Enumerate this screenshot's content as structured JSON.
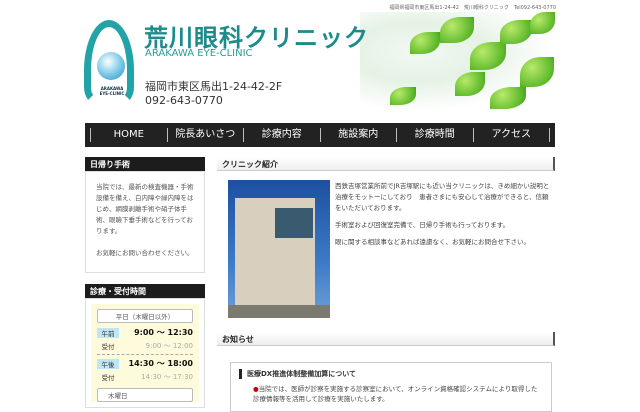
{
  "topline": "福岡県福岡市東区馬出1-24-42　荒川眼科クリニック　Tel092-643-0770",
  "logo": {
    "caption_1": "ARAKAWA",
    "caption_2": "EYE-CLINIC"
  },
  "header": {
    "title": "荒川眼科クリニック",
    "subtitle": "ARAKAWA EYE-CLINIC",
    "address": "福岡市東区馬出1-24-42-2F",
    "tel": "092-643-0770"
  },
  "nav": [
    "HOME",
    "院長あいさつ",
    "診療内容",
    "施設案内",
    "診療時間",
    "アクセス"
  ],
  "sidebar": {
    "daysurgery": {
      "title": "日帰り手術",
      "text": "当院では、最新の検査機器・手術設備を備え、白内障や緑内障をはじめ、網膜剥離手術や硝子体手術、眼瞼下垂手術などを行っております。",
      "text2": "お気軽にお問い合わせください。"
    },
    "hours": {
      "title": "診療・受付時間",
      "weekday": "平日（木曜日以外）",
      "am_label": "午前",
      "am_time": "9:00 〜 12:30",
      "am_rec_label": "受付",
      "am_rec": "9:00 〜 12:00",
      "pm_label": "午後",
      "pm_time": "14:30 〜 18:00",
      "pm_rec_label": "受付",
      "pm_rec": "14:30 〜 17:30",
      "thursday": "木曜日"
    }
  },
  "main": {
    "intro": {
      "title": "クリニック紹介",
      "p1": "西鉄吉塚営業所前でJR吉塚駅にも近い当クリニックは、きめ細かい説明と治療をモットーにしており　患者さまにも安心して治療ができると、信頼をいただいております。",
      "p2": "手術室および回復室完備で、日帰り手術も行っております。",
      "p3": "眼に関する相談事などあれば遠慮なく、お気軽にお問合せ下さい。"
    },
    "news": {
      "title": "お知らせ",
      "item_title": "医療DX推進体制整備加算について",
      "item_body": "当院では、医師が診察を実施する診察室において、オンライン資格確認システムにより取得した診療情報等を活用して診療を実施いたします。"
    }
  }
}
